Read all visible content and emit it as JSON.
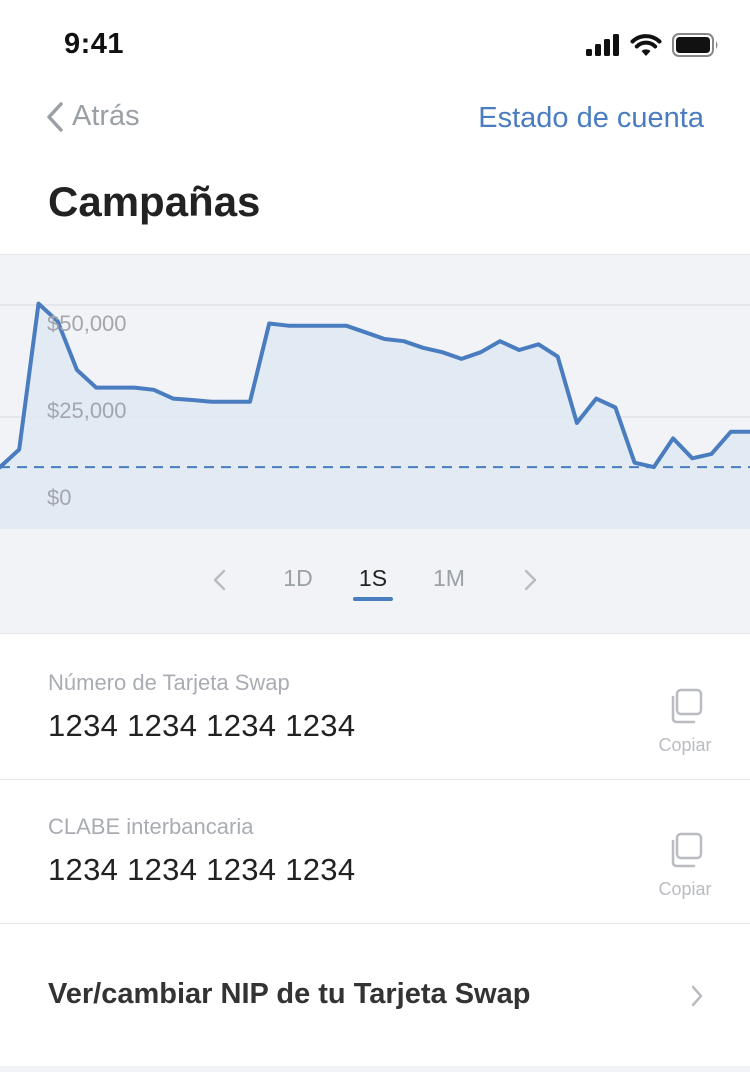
{
  "status_bar": {
    "time": "9:41"
  },
  "nav": {
    "back_label": "Atrás",
    "statement_link": "Estado de cuenta"
  },
  "page_title": "Campañas",
  "chart_data": {
    "type": "area",
    "title": "",
    "xlabel": "",
    "ylabel": "",
    "ylim": [
      0,
      62000
    ],
    "y_tick_labels": [
      "$50,000",
      "$25,000",
      "$0"
    ],
    "y_ticks": [
      50000,
      25000,
      0
    ],
    "reference_line": 14000,
    "grid": true,
    "colors": {
      "line": "#4a7cc0",
      "fill": "#dfe7f3",
      "reference": "#4a7cc0",
      "tick_text": "#a3a7ad",
      "grid": "#e0e2e6"
    },
    "series": [
      {
        "values": [
          14000,
          18000,
          51000,
          47000,
          36000,
          32000,
          32000,
          32000,
          31500,
          29500,
          29200,
          28800,
          28800,
          28800,
          46500,
          46000,
          46000,
          46000,
          46000,
          44500,
          43000,
          42500,
          41000,
          40000,
          38500,
          40000,
          42500,
          40500,
          41800,
          39000,
          24000,
          29500,
          27500,
          15000,
          14000,
          20500,
          16000,
          17000,
          22000,
          22000
        ]
      }
    ]
  },
  "periods": {
    "items": [
      "1D",
      "1S",
      "1M"
    ],
    "selected": "1S"
  },
  "card_number": {
    "label": "Número de Tarjeta Swap",
    "value": "1234 1234 1234 1234",
    "copy_label": "Copiar"
  },
  "clabe": {
    "label": "CLABE interbancaria",
    "value": "1234 1234 1234 1234",
    "copy_label": "Copiar"
  },
  "nip_row": {
    "label": "Ver/cambiar NIP de tu Tarjeta Swap"
  }
}
